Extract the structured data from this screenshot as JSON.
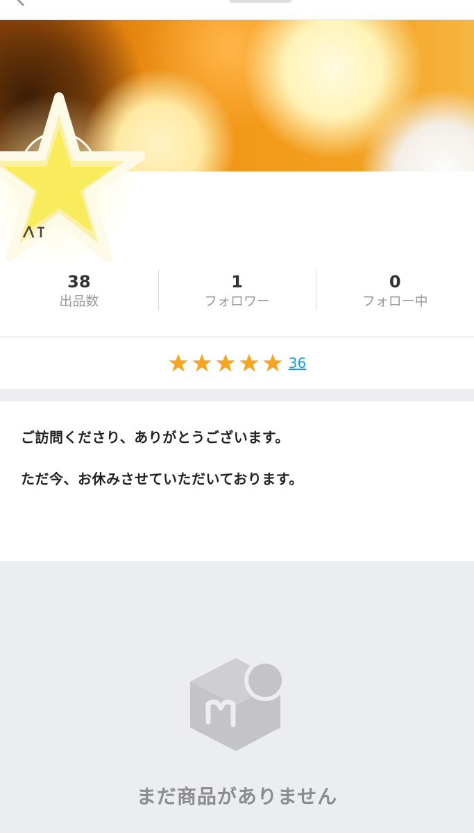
{
  "stats": [
    {
      "value": "38",
      "label": "出品数"
    },
    {
      "value": "1",
      "label": "フォロワー"
    },
    {
      "value": "0",
      "label": "フォロー中"
    }
  ],
  "rating": {
    "stars": 5,
    "count": "36",
    "star_color": "#f5a623",
    "link_color": "#1a9bd3"
  },
  "message": {
    "line1": "ご訪問くださり、ありがとうございます。",
    "line2": "ただ今、お休みさせていただいております。"
  },
  "empty_state": {
    "text": "まだ商品がありません",
    "icon": "mercari-box-icon"
  },
  "colors": {
    "background": "#ffffff",
    "empty_bg": "#ecedf1",
    "muted_text": "#9a9a9a"
  }
}
